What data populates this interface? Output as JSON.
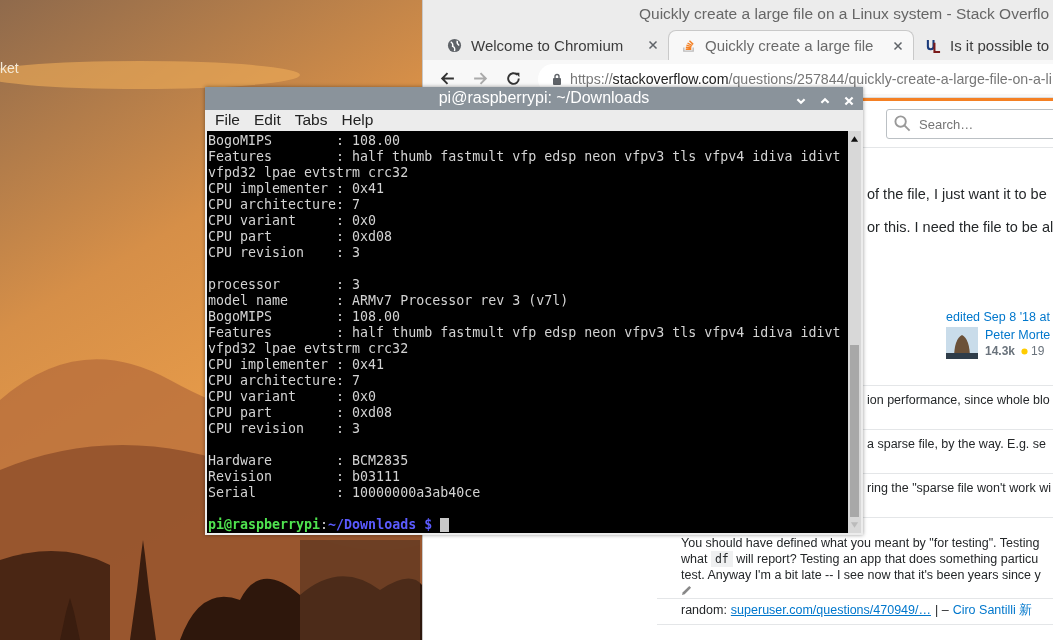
{
  "desktop": {
    "icon_label": "ket"
  },
  "browser": {
    "window_title": "Quickly create a large file on a Linux system - Stack Overflo",
    "tabs": [
      {
        "title": "Welcome to Chromium",
        "selected": false
      },
      {
        "title": "Quickly create a large file",
        "selected": true
      },
      {
        "title": "Is it possible to",
        "selected": false
      }
    ],
    "forward_disabled": true,
    "url": {
      "scheme": "https://",
      "host": "stackoverflow.com",
      "path": "/questions/257844/quickly-create-a-large-file-on-a-li"
    },
    "page": {
      "search_placeholder": "Search…",
      "question_lines": [
        "of the file, I just want it to be",
        "or this. I need the file to be al"
      ],
      "edit_info": "edited Sep 8 '18 at",
      "editor": {
        "name": "Peter Morte",
        "reputation": "14.3k",
        "gold_badges": "19"
      },
      "comments": [
        {
          "lines": [
            "ion performance, since whole blo"
          ]
        },
        {
          "lines": [
            "a sparse file, by the way. E.g. se"
          ]
        },
        {
          "lines": [
            "ring the \"sparse file won't work wi"
          ]
        },
        {
          "lines": [
            "You should have defined what you meant by \"for testing\". Testing"
          ],
          "code_line": {
            "before": "what ",
            "code": "df",
            "after": " will report? Testing an app that does something particu"
          },
          "last_line": "test. Anyway I'm a bit late -- I see now that it's been years since y",
          "edited": true
        },
        {
          "prefix": "random:",
          "link": "superuser.com/questions/470949/…",
          "separator": "| –",
          "author": "Ciro Santilli 新"
        }
      ]
    }
  },
  "terminal": {
    "title": "pi@raspberrypi: ~/Downloads",
    "menu": [
      "File",
      "Edit",
      "Tabs",
      "Help"
    ],
    "blocks": [
      [
        "BogoMIPS        : 108.00",
        "Features        : half thumb fastmult vfp edsp neon vfpv3 tls vfpv4 idiva idivt",
        "vfpd32 lpae evtstrm crc32",
        "CPU implementer : 0x41",
        "CPU architecture: 7",
        "CPU variant     : 0x0",
        "CPU part        : 0xd08",
        "CPU revision    : 3"
      ],
      [
        "processor       : 3",
        "model name      : ARMv7 Processor rev 3 (v7l)",
        "BogoMIPS        : 108.00",
        "Features        : half thumb fastmult vfp edsp neon vfpv3 tls vfpv4 idiva idivt",
        "vfpd32 lpae evtstrm crc32",
        "CPU implementer : 0x41",
        "CPU architecture: 7",
        "CPU variant     : 0x0",
        "CPU part        : 0xd08",
        "CPU revision    : 3"
      ],
      [
        "Hardware        : BCM2835",
        "Revision        : b03111",
        "Serial          : 10000000a3ab40ce"
      ]
    ],
    "prompt": {
      "user_host": "pi@raspberrypi",
      "separator": ":",
      "path": "~/Downloads",
      "symbol": "$"
    }
  }
}
